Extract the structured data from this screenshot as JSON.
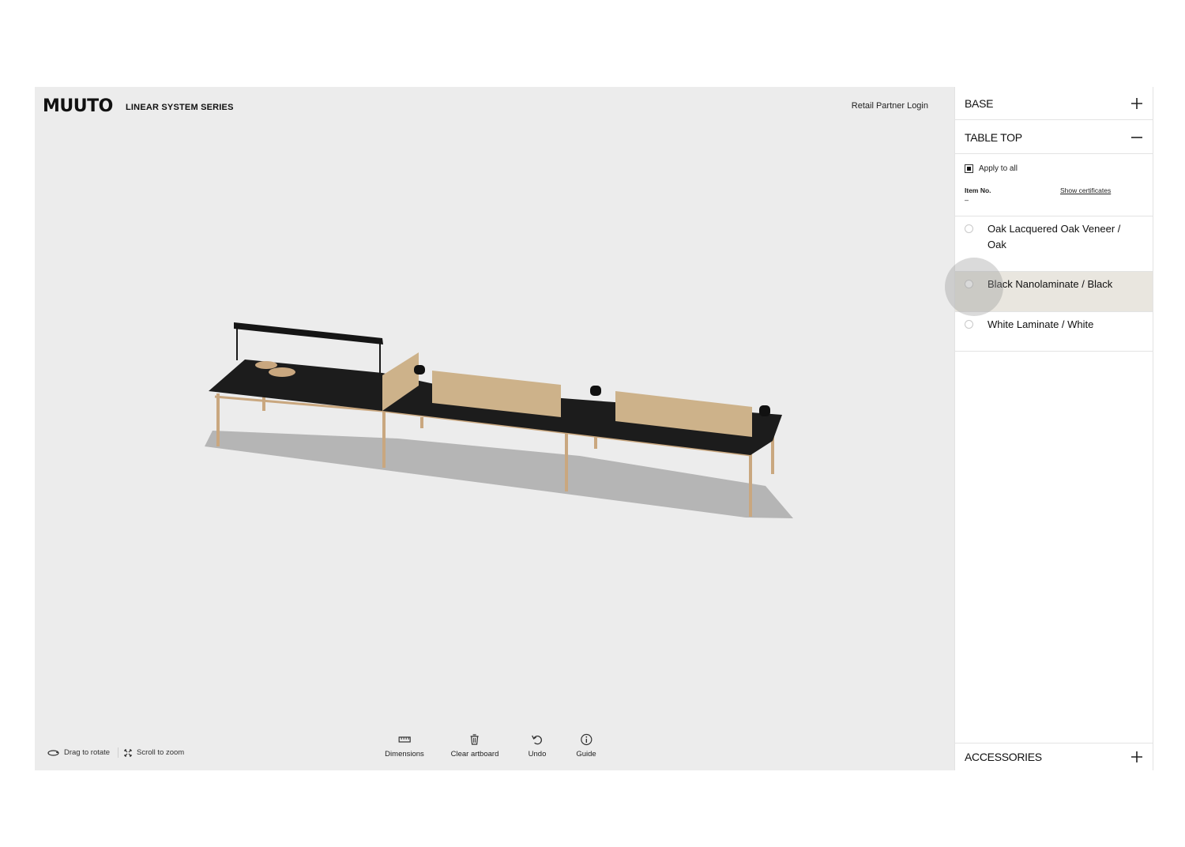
{
  "brand": {
    "logo": "MUUTO",
    "series": "LINEAR SYSTEM SERIES"
  },
  "header": {
    "retail_login": "Retail Partner Login"
  },
  "hints": {
    "rotate": "Drag to rotate",
    "zoom": "Scroll to zoom"
  },
  "toolbar": {
    "dimensions": "Dimensions",
    "clear": "Clear artboard",
    "undo": "Undo",
    "guide": "Guide"
  },
  "panel": {
    "base": "BASE",
    "table_top": "TABLE TOP",
    "apply_to_all": "Apply to all",
    "item_no_label": "Item No.",
    "item_no_value": "–",
    "show_certificates": "Show certificates",
    "options": [
      {
        "label": "Oak Lacquered Oak Veneer / Oak",
        "selected": false
      },
      {
        "label": "Black Nanolaminate / Black",
        "selected": true
      },
      {
        "label": "White Laminate / White",
        "selected": false
      }
    ],
    "accessories": "ACCESSORIES"
  },
  "colors": {
    "tabletop": "#1c1c1c",
    "wood": "#c9a77f",
    "screen": "#cdb28a",
    "highlight": "#e9e6df"
  }
}
